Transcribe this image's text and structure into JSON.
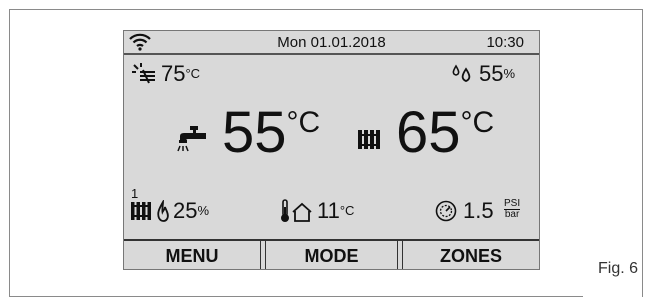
{
  "status": {
    "date": "Mon 01.01.2018",
    "time": "10:30",
    "wifi_icon": "wifi-icon"
  },
  "readings": {
    "solar_temp": {
      "value": "75",
      "unit": "°C",
      "icon": "solar-panel-icon"
    },
    "humidity": {
      "value": "55",
      "unit": "%",
      "icon": "droplets-icon"
    },
    "dhw_temp": {
      "value": "55",
      "unit": "°C",
      "icon": "faucet-icon"
    },
    "heating_temp": {
      "value": "65",
      "unit": "°C",
      "icon": "radiator-icon"
    },
    "zone": {
      "number": "1",
      "flame_value": "25",
      "unit": "%",
      "icon": "radiator-flame-icon"
    },
    "outdoor_temp": {
      "value": "11",
      "unit": "°C",
      "icon": "thermometer-house-icon"
    },
    "pressure": {
      "value": "1.5",
      "unit_top": "PSI",
      "unit_bottom": "bar",
      "icon": "pressure-gauge-icon"
    }
  },
  "buttons": {
    "menu": "MENU",
    "mode": "MODE",
    "zones": "ZONES"
  },
  "caption": "Fig. 6"
}
